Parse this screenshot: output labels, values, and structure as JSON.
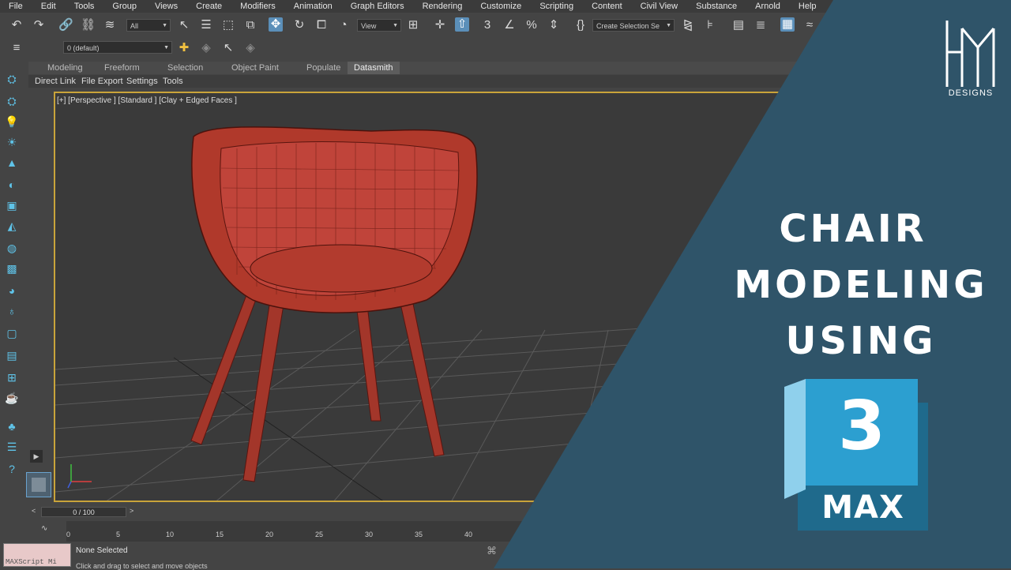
{
  "menu": [
    "File",
    "Edit",
    "Tools",
    "Group",
    "Views",
    "Create",
    "Modifiers",
    "Animation",
    "Graph Editors",
    "Rendering",
    "Customize",
    "Scripting",
    "Content",
    "Civil View",
    "Substance",
    "Arnold",
    "Help"
  ],
  "toolbar": {
    "selection_filter": "All",
    "reference_coord": "View",
    "named_selection": "Create Selection Se",
    "layer": "0 (default)"
  },
  "ribbon": {
    "tabs": [
      "Modeling",
      "Freeform",
      "Selection",
      "Object Paint",
      "Populate",
      "Datasmith"
    ],
    "active_tab": "Datasmith",
    "sub_items": [
      "Direct Link",
      "File Export",
      "Settings",
      "Tools"
    ]
  },
  "viewport": {
    "label": "[+] [Perspective ] [Standard ] [Clay + Edged Faces ]"
  },
  "timeline": {
    "frame": "0 / 100",
    "ticks": [
      "0",
      "5",
      "10",
      "15",
      "20",
      "25",
      "30",
      "35",
      "40"
    ]
  },
  "status": {
    "selection": "None Selected",
    "prompt": "Click and drag to select and move objects",
    "maxscript": "MAXScript Mi"
  },
  "overlay": {
    "title_lines": [
      "CHAIR",
      "MODELING",
      "USING"
    ],
    "logo_number": "3",
    "logo_label": "MAX",
    "brand": "DESIGNS",
    "banner_color": "#2f5469",
    "logo_color": "#2c9fd0"
  },
  "colors": {
    "viewport_border": "#c9a43a",
    "chair": "#b0392b"
  }
}
